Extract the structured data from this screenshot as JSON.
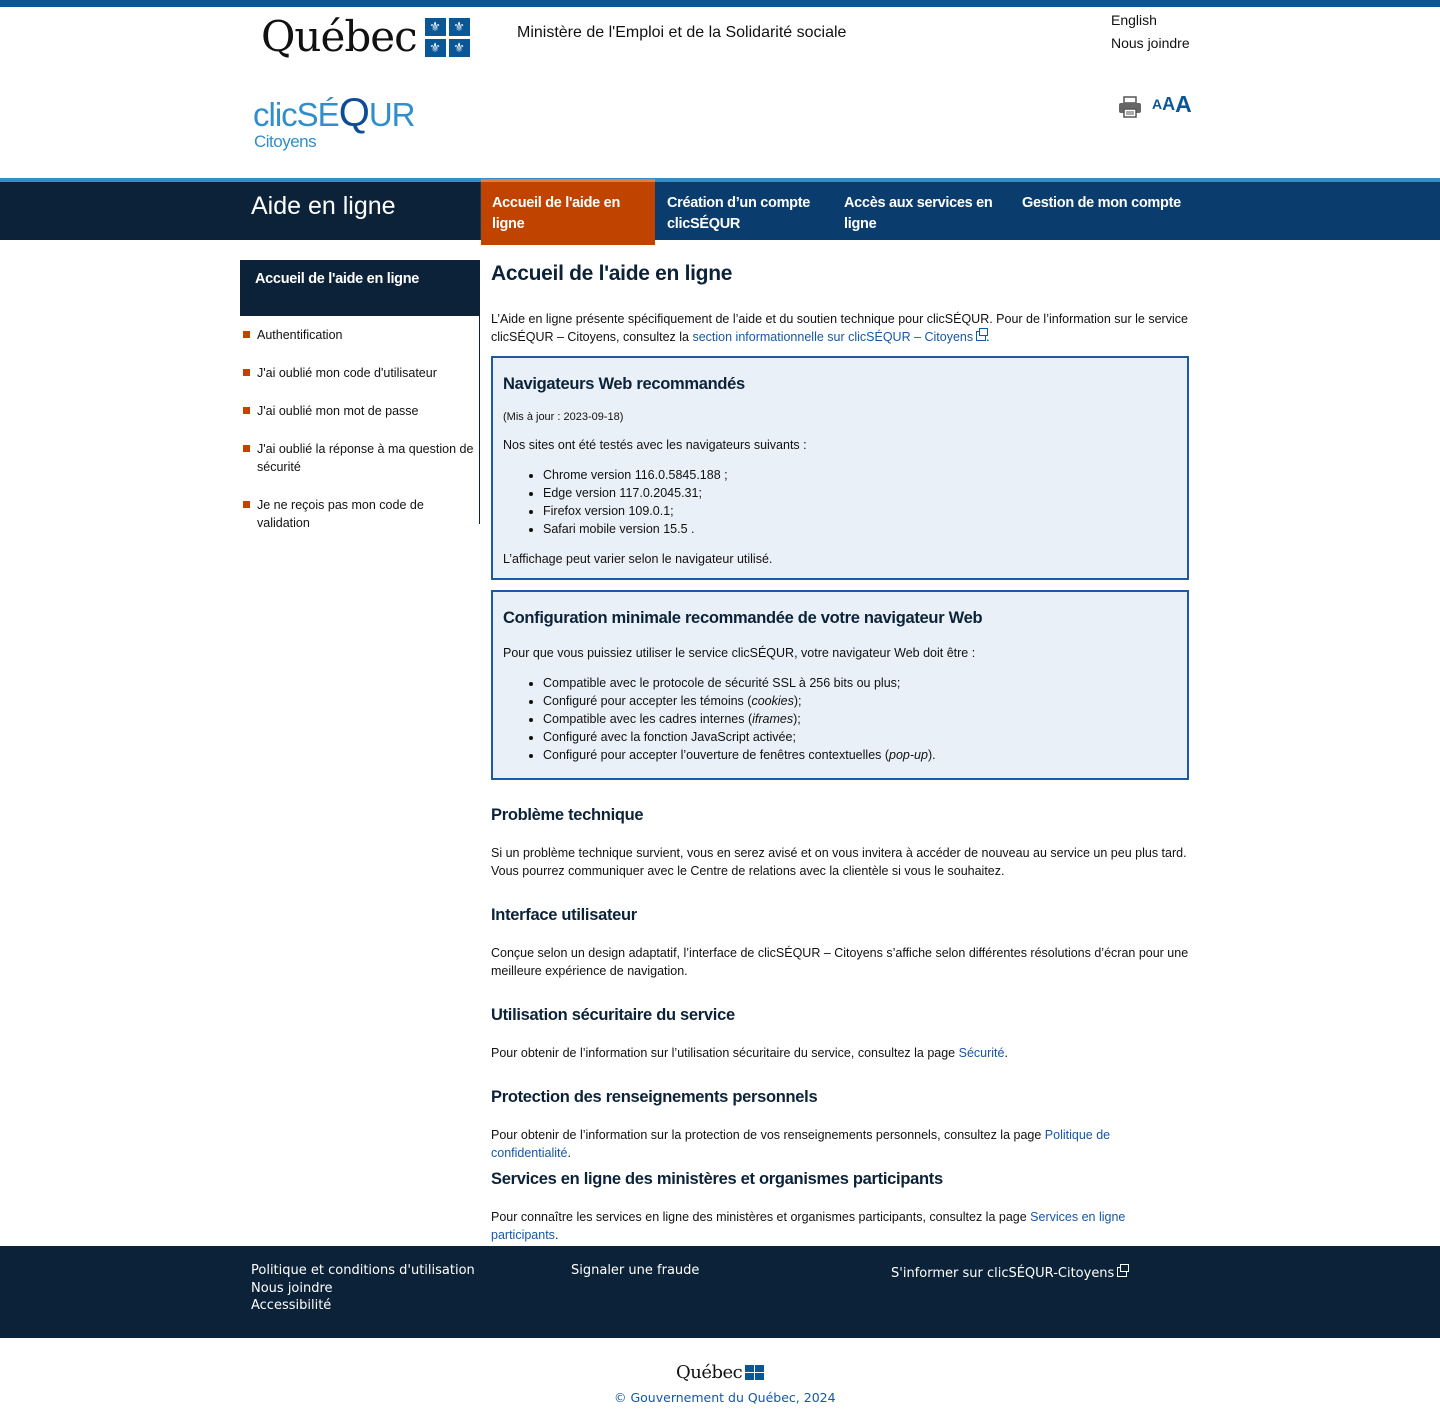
{
  "header": {
    "gov_logo_text": "Québec",
    "ministry": "Ministère de l'Emploi et de la Solidarité sociale",
    "lang_link": "English",
    "contact_link": "Nous joindre",
    "brand_name": "clicSÉ",
    "brand_q": "Q",
    "brand_end": "UR",
    "brand_sub": "Citoyens",
    "print_icon": "printer-icon",
    "text_size": [
      "A",
      "A",
      "A"
    ]
  },
  "nav": {
    "title": "Aide en ligne",
    "items": [
      {
        "label": "Accueil de l'aide en ligne",
        "active": true
      },
      {
        "label": "Création d’un compte clicSÉQUR"
      },
      {
        "label": "Accès aux services en ligne"
      },
      {
        "label": "Gestion de mon compte"
      }
    ]
  },
  "sidebar": {
    "heading": "Accueil de l'aide en ligne",
    "items": [
      "Authentification",
      "J'ai oublié mon code d'utilisateur",
      "J'ai oublié mon mot de passe",
      "J'ai oublié la réponse à ma question de sécurité",
      "Je ne reçois pas mon code de validation"
    ]
  },
  "main": {
    "title": "Accueil de l'aide en ligne",
    "intro_before": "L’Aide en ligne présente spécifiquement de l’aide et du soutien technique pour clicSÉQUR. Pour de l’information sur le service clicSÉQUR – Citoyens, consultez la ",
    "intro_link": "section informationnelle sur clicSÉQUR – Citoyens",
    "intro_after": ".",
    "box1": {
      "title": "Navigateurs Web recommandés",
      "updated": "(Mis à jour : 2023-09-18)",
      "lead": "Nos sites ont été testés avec les navigateurs suivants :",
      "items": [
        "Chrome version 116.0.5845.188 ;",
        "Edge version 117.0.2045.31;",
        "Firefox version 109.0.1;",
        "Safari mobile version 15.5 ."
      ],
      "note": "L’affichage peut varier selon le navigateur utilisé."
    },
    "box2": {
      "title": "Configuration minimale recommandée de votre navigateur Web",
      "lead": "Pour que vous puissiez utiliser le service clicSÉQUR, votre navigateur Web doit être :",
      "item1": "Compatible avec le protocole de sécurité SSL à 256 bits ou plus;",
      "item2_a": "Configuré pour accepter les témoins (",
      "item2_em": "cookies",
      "item2_b": ");",
      "item3_a": "Compatible avec les cadres internes (",
      "item3_em": "iframes",
      "item3_b": ");",
      "item4": "Configuré avec la fonction JavaScript activée;",
      "item5_a": "Configuré pour accepter l’ouverture de fenêtres contextuelles (",
      "item5_em": "pop-up",
      "item5_b": ")."
    },
    "sections": {
      "tech_title": "Problème technique",
      "tech_text": "Si un problème technique survient, vous en serez avisé et on vous invitera à accéder de nouveau au service un peu plus tard. Vous pourrez communiquer avec le Centre de relations avec la clientèle si vous le souhaitez.",
      "ui_title": "Interface utilisateur",
      "ui_text": "Conçue selon un design adaptatif, l’interface de clicSÉQUR – Citoyens s’affiche selon différentes résolutions d’écran pour une meilleure expérience de navigation.",
      "sec_title": "Utilisation sécuritaire du service",
      "sec_text": "Pour obtenir de l’information sur l’utilisation sécuritaire du service, consultez la page ",
      "sec_link": "Sécurité",
      "priv_title": "Protection des renseignements personnels",
      "priv_text": "Pour obtenir de l’information sur la protection de vos renseignements personnels, consultez la page ",
      "priv_link": "Politique de confidentialité",
      "svc_title": "Services en ligne des ministères et organismes participants",
      "svc_text": "Pour connaître les services en ligne des ministères et organismes participants, consultez la page ",
      "svc_link": "Services en ligne participants",
      "period": "."
    }
  },
  "footer": {
    "col1": [
      "Politique et conditions d'utilisation",
      "Nous joindre",
      "Accessibilité"
    ],
    "col2": [
      "Signaler une fraude"
    ],
    "col3": [
      "S'informer sur clicSÉQUR-Citoyens"
    ],
    "logo_text": "Québec",
    "copyright": "© Gouvernement du Québec, 2024"
  },
  "colors": {
    "primary": "#095797",
    "dark": "#0c2238",
    "accent": "#c04300",
    "link": "#1557a8",
    "box_bg": "#e9f0f8"
  }
}
